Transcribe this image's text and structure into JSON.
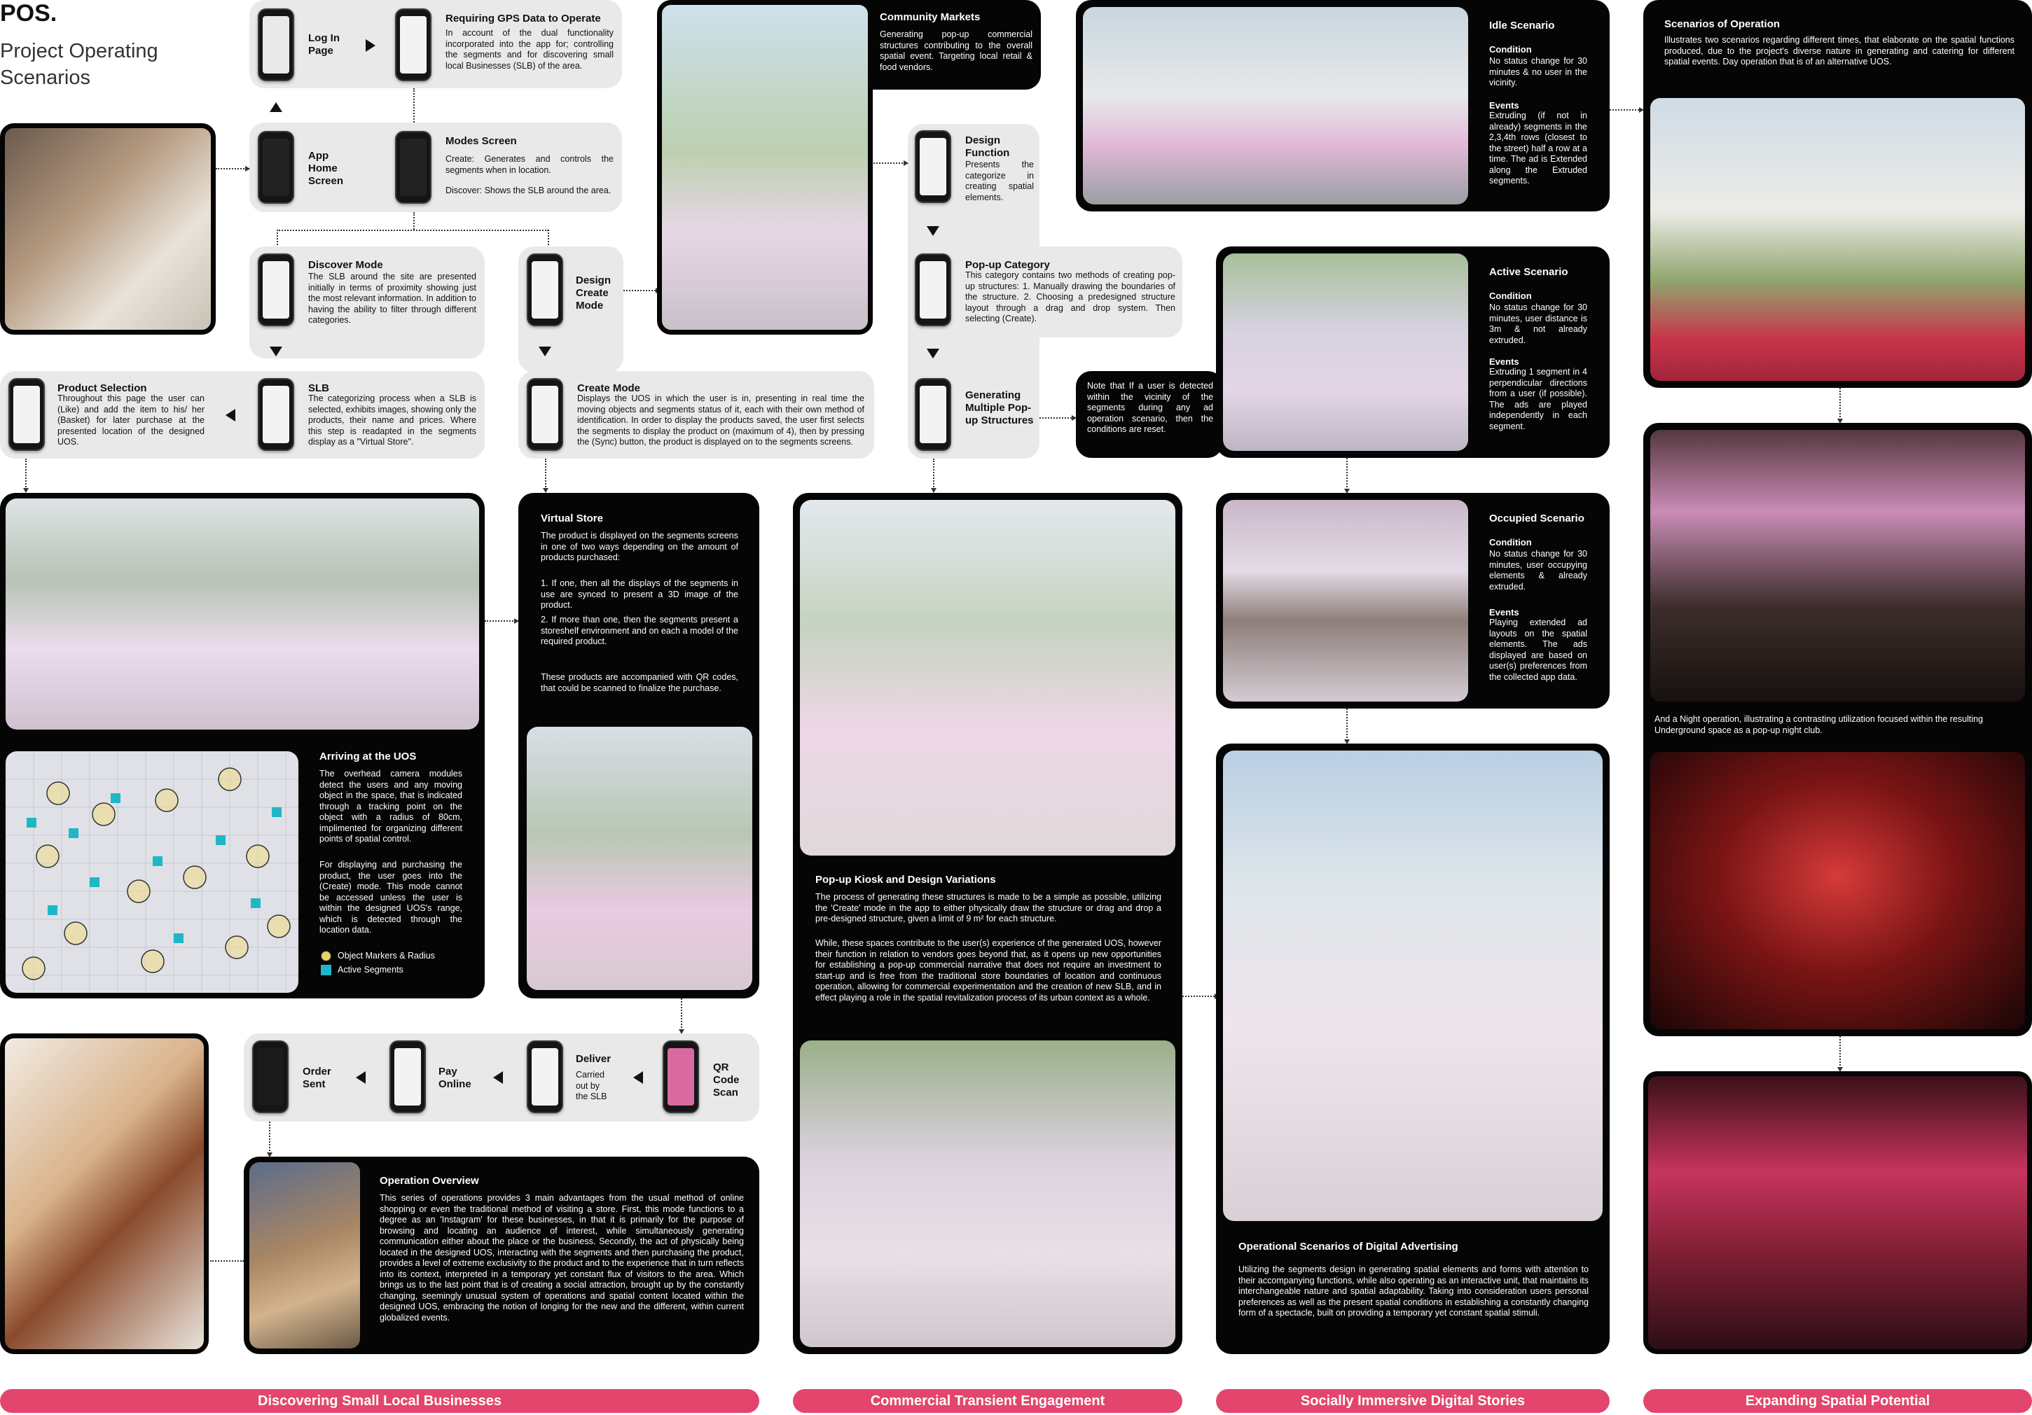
{
  "page": {
    "logo": "POS.",
    "title_line1": "Project Operating",
    "title_line2": "Scenarios"
  },
  "flow": {
    "login": {
      "label": "Log In Page"
    },
    "gps": {
      "title": "Requiring GPS Data to Operate",
      "text": "In account of the dual functionality incorporated into the app for; controlling the segments and for discovering small local Businesses (SLB) of the area."
    },
    "app_home": {
      "label": "App Home Screen"
    },
    "modes": {
      "title": "Modes Screen",
      "text1": "Create: Generates and controls the segments when in location.",
      "text2": "Discover: Shows the SLB around the area."
    },
    "discover": {
      "title": "Discover Mode",
      "text": "The SLB around the site are presented initially in terms of proximity showing just the most relevant information. In addition to having the ability to filter through different categories."
    },
    "design_create": {
      "label": "Design Create Mode"
    },
    "product_selection": {
      "title": "Product Selection",
      "text": "Throughout this page the user can (Like) and add the item to his/ her (Basket) for later purchase at the presented location of the designed UOS."
    },
    "slb": {
      "title": "SLB",
      "text": "The categorizing process when a SLB is selected, exhibits images, showing only the products, their name and prices. Where this step is readapted in the segments display as a \"Virtual Store\"."
    },
    "create_mode": {
      "title": "Create Mode",
      "text": "Displays the UOS in which the user is in, presenting in real time the moving objects and segments status of it, each with their own method of identification. In order to display the products saved, the user first selects the segments to display the product on (maximum of 4), then by pressing the (Sync) button, the product is displayed on to the segments screens."
    },
    "design_function": {
      "title": "Design Function",
      "text": "Presents the categorize in creating spatial elements."
    },
    "popup_category": {
      "title": "Pop-up Category",
      "text": "This category contains two methods of creating pop-up structures: 1. Manually drawing the boundaries of the structure. 2. Choosing a predesigned structure layout through a drag and drop system. Then selecting (Create)."
    },
    "generating": {
      "title": "Generating Multiple Pop-up Structures"
    },
    "community": {
      "title": "Community Markets",
      "text": "Generating pop-up commercial structures contributing to the overall spatial event. Targeting local retail & food vendors."
    }
  },
  "scenarios": {
    "idle": {
      "title": "Idle Scenario",
      "condition_title": "Condition",
      "condition": "No status change for 30 minutes & no user in the vicinity.",
      "events_title": "Events",
      "events": "Extruding (if not in already) segments in the 2,3,4th rows (closest to the street) half a row at a time. The ad is Extended along the Extruded segments."
    },
    "active": {
      "title": "Active Scenario",
      "condition_title": "Condition",
      "condition": "No status change for 30 minutes, user distance is 3m & not already extruded.",
      "events_title": "Events",
      "events": "Extruding 1 segment in 4 perpendicular directions from a user (if possible). The ads are played independently in each segment."
    },
    "note": "Note that If a user is detected within the vicinity of the segments during any ad operation scenario, then the conditions are reset.",
    "occupied": {
      "title": "Occupied Scenario",
      "condition_title": "Condition",
      "condition": "No status change for 30 minutes, user occupying elements & already extruded.",
      "events_title": "Events",
      "events": "Playing extended ad layouts on the spatial elements. The ads displayed are based on user(s) preferences from the collected app data."
    },
    "operational": {
      "title": "Operational Scenarios of Digital Advertising",
      "text": "Utilizing the segments design in generating spatial elements and forms with attention to their accompanying functions, while also operating as an interactive unit, that maintains its interchangeable nature and spatial adaptability. Taking into consideration users personal preferences as well as the present spatial conditions in establishing a constantly changing form of a spectacle, built on providing a temporary yet constant spatial stimuli."
    }
  },
  "operation": {
    "title": "Scenarios of Operation",
    "text": "Illustrates two scenarios regarding different times, that elaborate on the spatial functions produced, due to the project's diverse nature in generating and catering for different spatial events. Day operation that is of an alternative UOS.",
    "night": "And a Night operation, illustrating a contrasting utilization focused within the resulting Underground space as a pop-up night club."
  },
  "arriving": {
    "title": "Arriving at the UOS",
    "text1": "The overhead camera modules detect the users and any moving object in the space, that is indicated through a tracking point on the object with a radius of 80cm, implimented for organizing different points of spatial control.",
    "text2": "For displaying and purchasing the product, the user goes into the (Create) mode. This mode cannot be accessed unless the user is within the designed UOS's range, which is detected through the location data.",
    "legend": [
      {
        "label": "Object Markers & Radius",
        "color": "#e8d06a"
      },
      {
        "label": "Active Segments",
        "color": "#1fb7c8"
      }
    ]
  },
  "virtual_store": {
    "title": "Virtual Store",
    "text1": "The product is displayed on the segments screens in one of two ways depending on the amount of products purchased:",
    "text2": "1. If one, then all the displays of the segments in use are synced to present a 3D image of the product.",
    "text3": "2. If more than one, then the segments present a storeshelf environment and on each a model of the required product.",
    "text4": "These products are accompanied with QR codes, that could be scanned to finalize the purchase."
  },
  "kiosk": {
    "title": "Pop-up Kiosk and Design Variations",
    "text1": "The process of generating these structures is made to be a simple as possible, utilizing the 'Create' mode in the app to either physically draw the structure or drag and drop a pre-designed structure, given a limit of 9 m² for each structure.",
    "text2": "While, these spaces contribute to the user(s) experience of the generated UOS, however their function in relation to vendors goes beyond that, as it opens up new opportunities for establishing a pop-up commercial narrative that does not require an investment to start-up and is free from the traditional store boundaries of location and continuous operation, allowing for commercial experimentation and the creation of new SLB, and in effect playing a role in the spatial revitalization process of its urban context as a whole."
  },
  "purchase": {
    "qr": "QR Code Scan",
    "deliver": "Deliver",
    "deliver_note": "Carried out by the SLB",
    "pay": "Pay Online",
    "order": "Order Sent"
  },
  "overview": {
    "title": "Operation Overview",
    "text": "This series of operations provides 3 main advantages from the usual method of online shopping or even the traditional method of visiting a store. First, this mode functions to a degree as an 'Instagram' for these businesses, in that it is primarily for the purpose of browsing and locating an audience of interest, while simultaneously generating communication either about the place or the business. Secondly, the act of physically being located in the designed UOS, interacting with the segments and then purchasing the product, provides a level of extreme exclusivity to the product and to the experience that in turn reflects into its context, interpreted in a temporary yet constant flux of visitors to the area. Which brings us to the last point that is of creating a social attraction, brought up by the constantly changing, seemingly unusual system of operations and spatial content located within the designed UOS, embracing the notion of longing for the new and the different, within current globalized events."
  },
  "footer": {
    "sections": [
      "Discovering Small Local Businesses",
      "Commercial Transient Engagement",
      "Socially Immersive Digital Stories",
      "Expanding Spatial Potential"
    ],
    "color": "#e3456c"
  }
}
